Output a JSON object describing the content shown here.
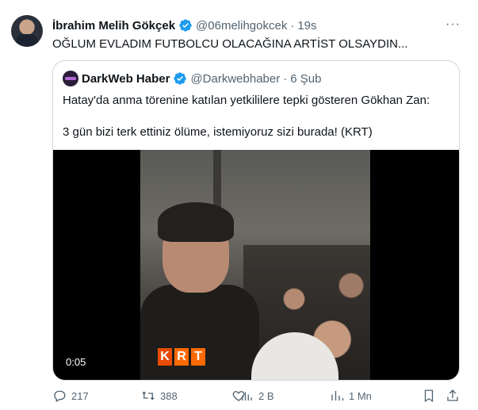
{
  "tweet": {
    "author_name": "İbrahim Melih Gökçek",
    "handle": "@06melihgokcek",
    "separator": "·",
    "time": "19s",
    "text": "OĞLUM EVLADIM FUTBOLCU OLACAĞINA ARTİST OLSAYDIN...",
    "more_label": "···"
  },
  "quote": {
    "author_name": "DarkWeb Haber",
    "handle": "@Darkwebhaber",
    "separator": "·",
    "date": "6 Şub",
    "text_line1": "Hatay'da anma törenine katılan yetkililere tepki gösteren Gökhan Zan:",
    "text_line2": "3 gün bizi terk ettiniz ölüme, istemiyoruz sizi burada! (KRT)",
    "video": {
      "timestamp": "0:05",
      "overlay_logo": [
        "K",
        "R",
        "T"
      ]
    }
  },
  "actions": {
    "replies": "217",
    "retweets": "388",
    "likes": "",
    "views": "2 B",
    "bookmarks_label": "1 Mn"
  },
  "colors": {
    "verified_badge": "#1d9bf0",
    "muted_text": "#536471",
    "border": "#cfd9de"
  },
  "icons": [
    "verified-badge-icon",
    "more-icon",
    "reply-icon",
    "retweet-icon",
    "like-icon",
    "views-icon",
    "bookmark-icon",
    "share-icon"
  ]
}
